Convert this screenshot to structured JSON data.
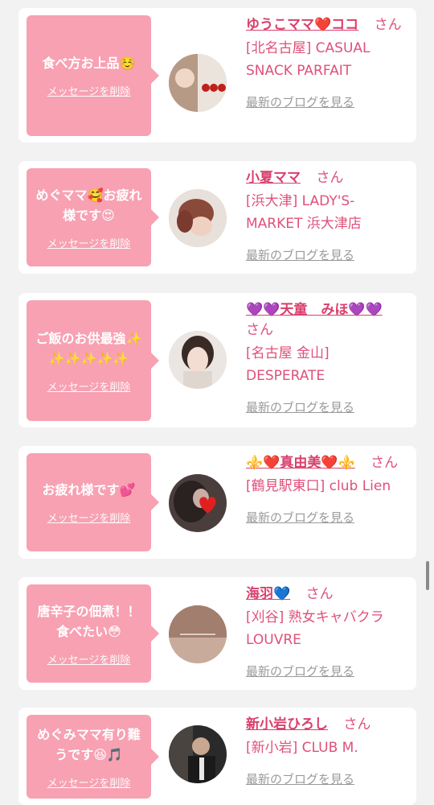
{
  "cards": [
    {
      "message": "食べ方お上品☺️",
      "delete_label": "メッセージを削除",
      "name": "ゆうこママ❤️ココ",
      "honorific": "さん",
      "store": "[北名古屋] CASUAL SNACK PARFAIT",
      "blog_link": "最新のブログを見る"
    },
    {
      "message": "めぐママ🥰お疲れ様です😍",
      "delete_label": "メッセージを削除",
      "name": "小夏ママ",
      "honorific": "さん",
      "store": "[浜大津] LADY'S-MARKET 浜大津店",
      "blog_link": "最新のブログを見る"
    },
    {
      "message": "ご飯のお供最強✨✨✨✨✨✨",
      "delete_label": "メッセージを削除",
      "name": "💜💜天童　みほ💜💜",
      "honorific": "さん",
      "store": "[名古屋 金山] DESPERATE",
      "blog_link": "最新のブログを見る"
    },
    {
      "message": "お疲れ様です💕",
      "delete_label": "メッセージを削除",
      "name": "⚜️❤️真由美❤️⚜️",
      "honorific": "さん",
      "store": "[鶴見駅東口] club Lien",
      "blog_link": "最新のブログを見る"
    },
    {
      "message": "唐辛子の佃煮！！食べたい😳",
      "delete_label": "メッセージを削除",
      "name": "海羽💙",
      "honorific": "さん",
      "store": "[刈谷] 熟女キャバクラ LOUVRE",
      "blog_link": "最新のブログを見る"
    },
    {
      "message": "めぐみママ有り難うです😆🎵",
      "delete_label": "メッセージを削除",
      "name": "新小岩ひろし",
      "honorific": "さん",
      "store": "[新小岩] CLUB M.",
      "blog_link": "最新のブログを見る"
    }
  ],
  "colors": {
    "bubble": "#f7a1b2",
    "name": "#d9406d",
    "store": "#e0507a",
    "blog": "#9a9a9a",
    "background": "#f2f2f2"
  }
}
